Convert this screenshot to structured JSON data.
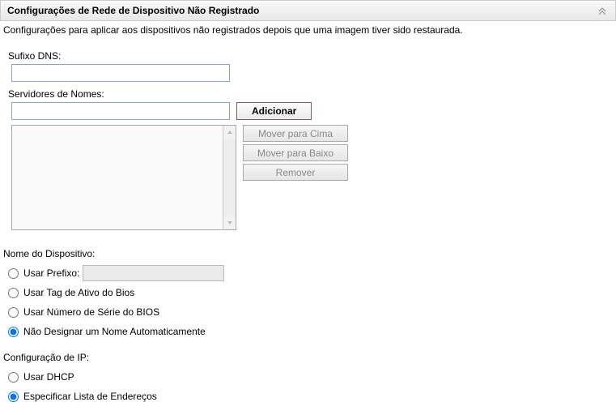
{
  "panel": {
    "title": "Configurações de Rede de Dispositivo Não Registrado",
    "description": "Configurações para aplicar aos dispositivos não registrados depois que uma imagem tiver sido restaurada."
  },
  "dns": {
    "label": "Sufixo DNS:",
    "value": ""
  },
  "nameServers": {
    "label": "Servidores de Nomes:",
    "input": "",
    "addButton": "Adicionar",
    "moveUpButton": "Mover para Cima",
    "moveDownButton": "Mover para Baixo",
    "removeButton": "Remover"
  },
  "deviceName": {
    "label": "Nome do Dispositivo:",
    "options": {
      "usePrefix": "Usar Prefixo:",
      "useBiosAssetTag": "Usar Tag de Ativo do Bios",
      "useBiosSerial": "Usar Número de Série do BIOS",
      "noAutoAssign": "Não Designar um Nome Automaticamente"
    },
    "prefixValue": "",
    "selected": "noAutoAssign"
  },
  "ipConfig": {
    "label": "Configuração de IP:",
    "options": {
      "useDhcp": "Usar DHCP",
      "specifyList": "Especificar Lista de Endereços"
    },
    "selected": "specifyList"
  }
}
